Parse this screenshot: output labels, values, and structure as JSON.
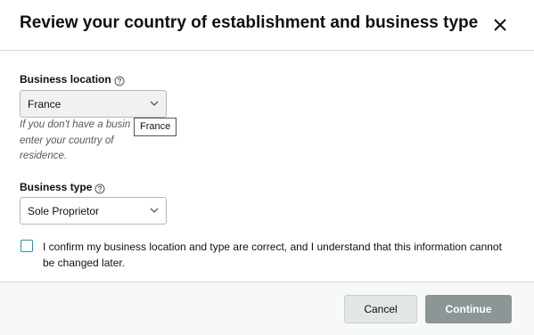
{
  "dialog": {
    "title": "Review your country of establishment and business type"
  },
  "business_location": {
    "label": "Business location",
    "selected": "France",
    "help_text": "If you don't have a business address, enter your country of residence.",
    "help_text_visible_line1": "If you don't have a busin",
    "help_text_visible_line2": "enter your country of",
    "help_text_visible_line3": "residence.",
    "tooltip": "France"
  },
  "business_type": {
    "label": "Business type",
    "selected": "Sole Proprietor"
  },
  "confirm": {
    "text": "I confirm my business location and type are correct, and I understand that this information cannot be changed later.",
    "checked": false
  },
  "footer": {
    "cancel_label": "Cancel",
    "continue_label": "Continue"
  },
  "colors": {
    "continue_disabled_bg": "#8d9696",
    "checkbox_border": "#2d8fa8",
    "footer_bg": "#f7f8f8"
  },
  "icons": {
    "close": "close-icon",
    "help": "question-circle-icon",
    "dropdown": "chevron-down-icon"
  }
}
